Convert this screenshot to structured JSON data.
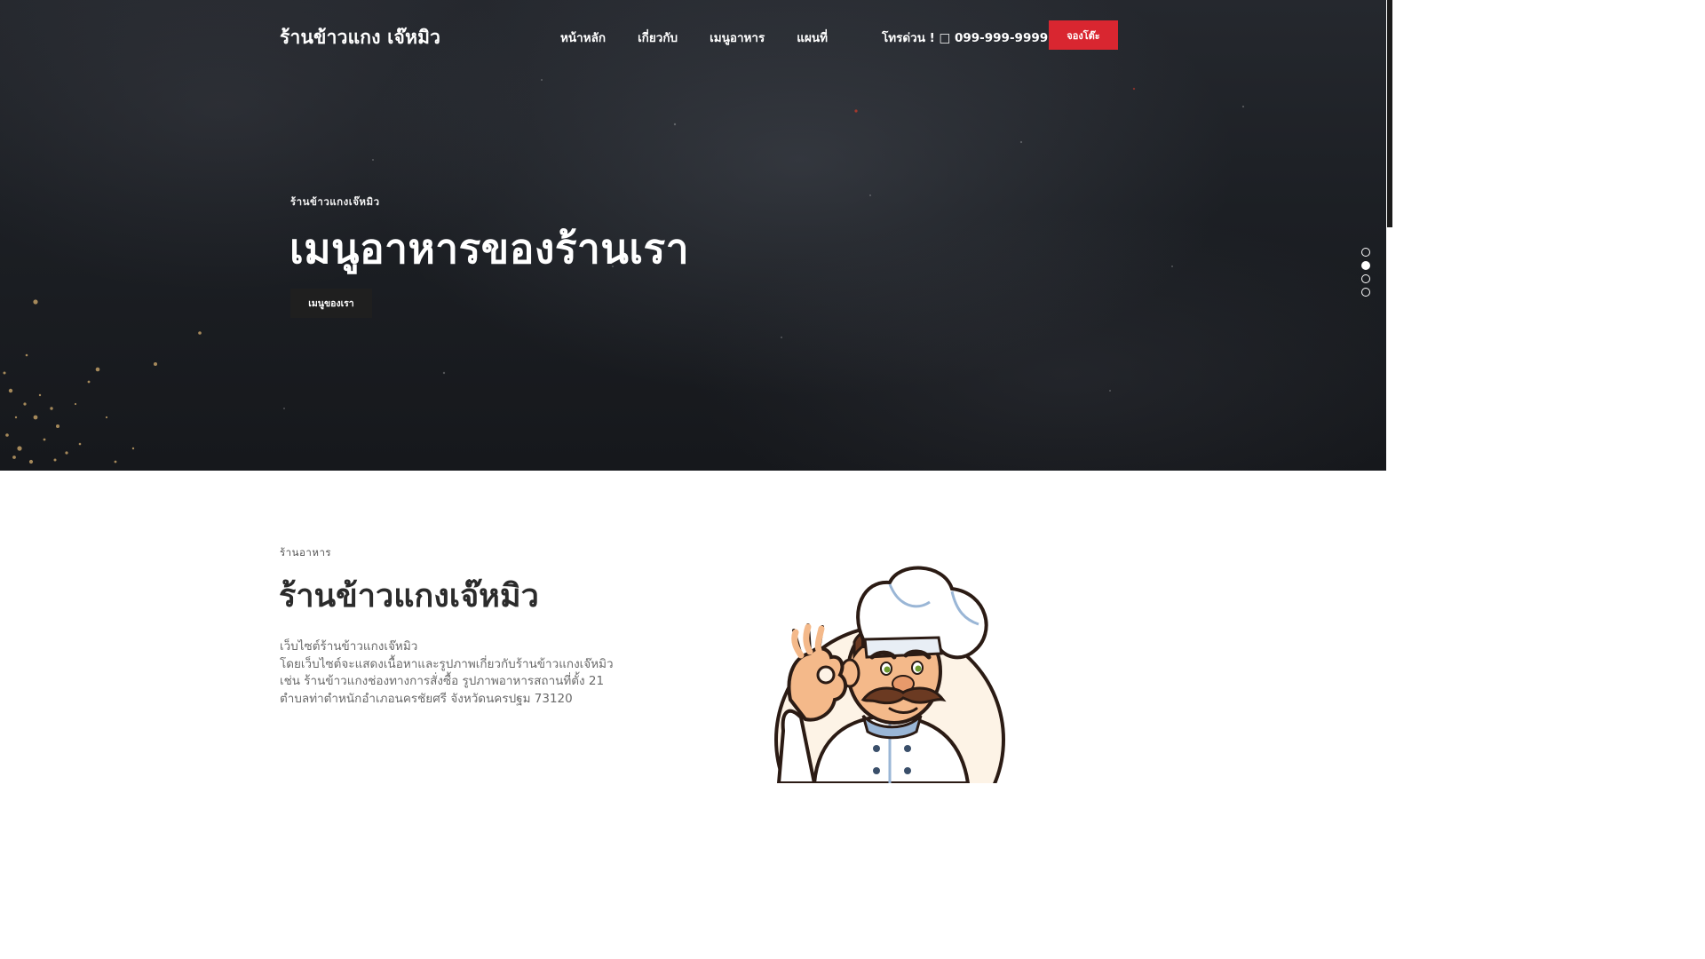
{
  "header": {
    "brand": "ร้านข้าวแกง เจ๊หมิว",
    "nav": [
      "หน้าหลัก",
      "เกี่ยวกับ",
      "เมนูอาหาร",
      "แผนที่"
    ],
    "hotline": "โทรด่วน ! □ 099-999-9999",
    "book_button": "จองโต๊ะ"
  },
  "hero": {
    "subtitle": "ร้านข้าวแกงเจ๊หมิว",
    "title": "เมนูอาหารของร้านเรา",
    "button": "เมนูของเรา",
    "slides": 4,
    "active_slide": 2
  },
  "about": {
    "kicker": "ร้านอาหาร",
    "title": "ร้านข้าวแกงเจ๊หมิว",
    "lines": [
      "เว็บไซต์ร้านข้าวแกงเจ๊หมิว",
      "โดยเว็บไซต์จะแสดงเนื้อหาและรูปภาพเกี่ยวกับร้านข้าวแกงเจ๊หมิว",
      "เช่น ร้านข้าวแกงช่องทางการสั่งซื้อ รูปภาพอาหารสถานที่ตั้ง 21",
      "ตำบลท่าตำหนักอำเภอนครชัยศรี จังหวัดนครปฐม 73120"
    ]
  },
  "colors": {
    "accent": "#d92630",
    "hero_bg": "#1c1f24",
    "dark_button": "#1f1f1f"
  },
  "icons": {
    "phone": "phone-icon",
    "chef": "chef-illustration"
  }
}
